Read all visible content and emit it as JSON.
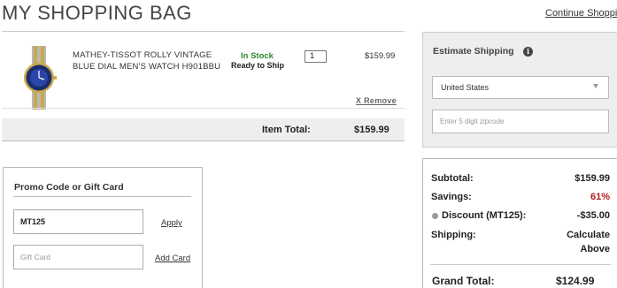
{
  "header": {
    "title": "MY SHOPPING BAG",
    "continue_link": "Continue Shopping"
  },
  "cart": {
    "item": {
      "name": "MATHEY-TISSOT ROLLY VINTAGE BLUE DIAL MEN'S WATCH H901BBU",
      "stock": "In Stock",
      "shipping": "Ready to Ship",
      "quantity": "1",
      "price": "$159.99",
      "remove_label": "X Remove",
      "image_icon": "watch-image"
    },
    "item_total_label": "Item Total:",
    "item_total_value": "$159.99"
  },
  "promo": {
    "title": "Promo Code or Gift Card",
    "promo_value": "MT125",
    "apply_label": "Apply",
    "giftcard_placeholder": "Gift Card",
    "add_card_label": "Add Card"
  },
  "shipping_estimate": {
    "title": "Estimate Shipping",
    "info_icon": "i",
    "country": "United States",
    "zip_placeholder": "Enter 5 digit zipcode"
  },
  "summary": {
    "subtotal_label": "Subtotal:",
    "subtotal_value": "$159.99",
    "savings_label": "Savings:",
    "savings_value": "61%",
    "discount_label": "Discount (MT125):",
    "discount_value": "-$35.00",
    "shipping_label": "Shipping:",
    "shipping_value_line1": "Calculate",
    "shipping_value_line2": "Above",
    "grand_total_label": "Grand Total:",
    "grand_total_value": "$124.99"
  },
  "colors": {
    "in_stock": "#2b8a2b",
    "savings": "#b21c1c",
    "panel_bg": "#eceeef"
  }
}
